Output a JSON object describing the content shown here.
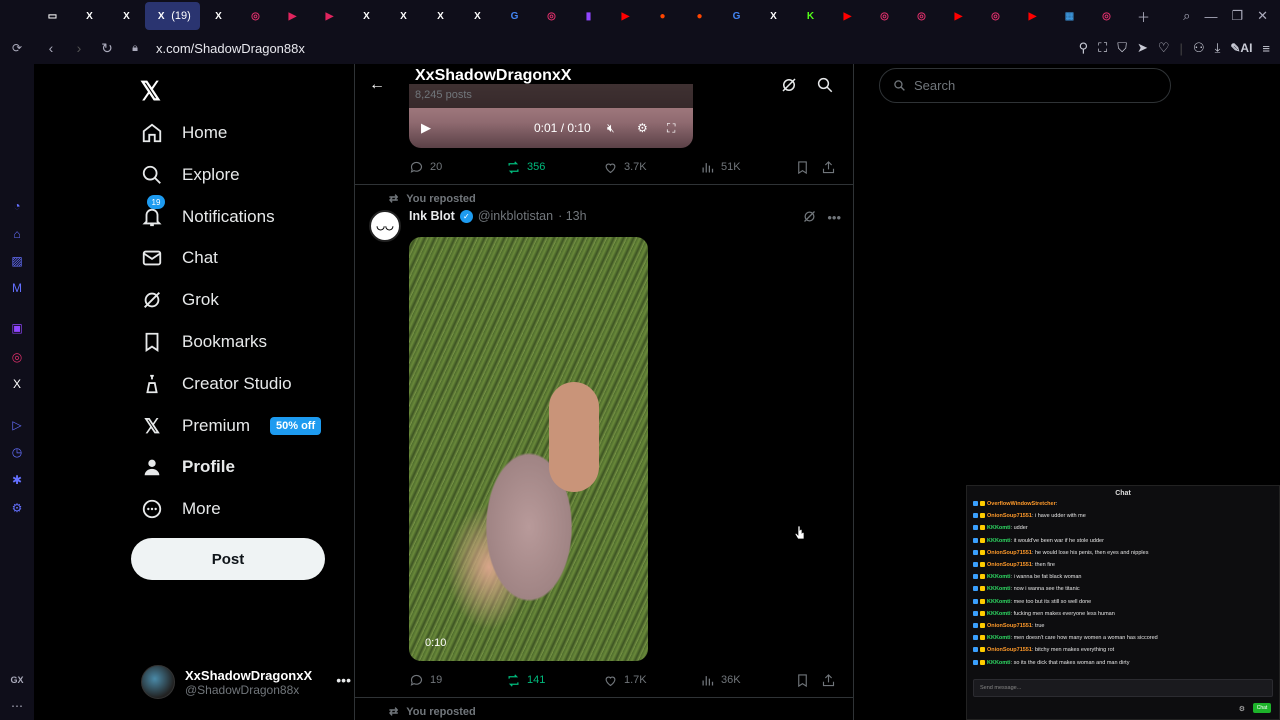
{
  "browser": {
    "active_tab_badge": "(19)",
    "url": "x.com/ShadowDragon88x",
    "ai_label": "AI",
    "gx_label": "GX",
    "tabs": [
      {
        "icon": "tv-icon",
        "color": "#ffffff"
      },
      {
        "icon": "x-icon",
        "color": "#ffffff"
      },
      {
        "icon": "x-icon",
        "color": "#ffffff"
      },
      {
        "icon": "x-icon",
        "color": "#ffffff",
        "active": true
      },
      {
        "icon": "x-icon",
        "color": "#ffffff"
      },
      {
        "icon": "instagram-icon",
        "color": "#e1306c"
      },
      {
        "icon": "play-icon",
        "color": "#e0245e"
      },
      {
        "icon": "play-icon",
        "color": "#e0245e"
      },
      {
        "icon": "x-icon",
        "color": "#ffffff"
      },
      {
        "icon": "x-icon",
        "color": "#ffffff"
      },
      {
        "icon": "x-icon",
        "color": "#ffffff"
      },
      {
        "icon": "x-icon",
        "color": "#ffffff"
      },
      {
        "icon": "google-icon",
        "color": "#4285f4"
      },
      {
        "icon": "instagram-icon",
        "color": "#e1306c"
      },
      {
        "icon": "twitch-icon",
        "color": "#9146ff"
      },
      {
        "icon": "youtube-icon",
        "color": "#ff0000"
      },
      {
        "icon": "reddit-icon",
        "color": "#ff4500"
      },
      {
        "icon": "reddit-icon",
        "color": "#ff4500"
      },
      {
        "icon": "google-icon",
        "color": "#4285f4"
      },
      {
        "icon": "x-icon",
        "color": "#ffffff"
      },
      {
        "icon": "kick-icon",
        "color": "#53fc18"
      },
      {
        "icon": "youtube-icon",
        "color": "#ff0000"
      },
      {
        "icon": "instagram-icon",
        "color": "#e1306c"
      },
      {
        "icon": "instagram-icon",
        "color": "#e1306c"
      },
      {
        "icon": "youtube-icon",
        "color": "#ff0000"
      },
      {
        "icon": "instagram-icon",
        "color": "#e1306c"
      },
      {
        "icon": "youtube-icon",
        "color": "#ff0000"
      },
      {
        "icon": "tweetdeck-icon",
        "color": "#3b94d9"
      },
      {
        "icon": "instagram-icon",
        "color": "#e1306c"
      }
    ]
  },
  "nav": {
    "items": [
      {
        "label": "Home",
        "icon": "home-icon"
      },
      {
        "label": "Explore",
        "icon": "search-icon"
      },
      {
        "label": "Notifications",
        "icon": "bell-icon",
        "badge": "19"
      },
      {
        "label": "Chat",
        "icon": "mail-icon"
      },
      {
        "label": "Grok",
        "icon": "grok-icon"
      },
      {
        "label": "Bookmarks",
        "icon": "bookmark-icon"
      },
      {
        "label": "Creator Studio",
        "icon": "creator-studio-icon"
      },
      {
        "label": "Premium",
        "icon": "x-icon",
        "badge": "50% off"
      },
      {
        "label": "Profile",
        "icon": "person-icon"
      },
      {
        "label": "More",
        "icon": "more-circle-icon"
      }
    ],
    "post_label": "Post",
    "account": {
      "name": "XxShadowDragonxX",
      "handle": "@ShadowDragon88x"
    }
  },
  "header": {
    "title": "XxShadowDragonxX",
    "post_count": "8,245 posts"
  },
  "first_post": {
    "video_time": "0:01 / 0:10",
    "replies": "20",
    "reposts": "356",
    "likes": "3.7K",
    "views": "51K"
  },
  "second_post": {
    "repost_label": "You reposted",
    "author_name": "Ink Blot",
    "author_handle": "@inkblotistan",
    "time": "· 13h",
    "video_duration": "0:10",
    "replies": "19",
    "reposts": "141",
    "likes": "1.7K",
    "views": "36K"
  },
  "third_post": {
    "repost_label": "You reposted"
  },
  "search": {
    "placeholder": "Search"
  },
  "chat": {
    "title": "Chat",
    "input_placeholder": "Send message...",
    "send_label": "Chat",
    "messages": [
      {
        "user": "OverflowWindowStretcher",
        "text": "",
        "color": "orange"
      },
      {
        "user": "OnionSoup71551",
        "text": "i have udder with me",
        "color": "orange"
      },
      {
        "user": "KKKomti",
        "text": "udder",
        "color": "green"
      },
      {
        "user": "KKKomti",
        "text": "it would've been war if he stole udder",
        "color": "green"
      },
      {
        "user": "OnionSoup71551",
        "text": "he would lose his penis, then eyes and nipples",
        "color": "orange"
      },
      {
        "user": "OnionSoup71551",
        "text": "then fire",
        "color": "orange"
      },
      {
        "user": "KKKomti",
        "text": "i wanna be fat black woman",
        "color": "green"
      },
      {
        "user": "KKKomti",
        "text": "now i wanna see the titanic",
        "color": "green"
      },
      {
        "user": "KKKomti",
        "text": "mee too but its still so well done",
        "color": "green"
      },
      {
        "user": "KKKomti",
        "text": "fucking men makes everyone less human",
        "color": "green"
      },
      {
        "user": "OnionSoup71551",
        "text": "true",
        "color": "orange"
      },
      {
        "user": "KKKomti",
        "text": "men doesn't care how many women a woman has siccored",
        "color": "green"
      },
      {
        "user": "OnionSoup71551",
        "text": "bitchy men makes everything rot",
        "color": "orange"
      },
      {
        "user": "KKKomti",
        "text": "so its the dick that makes woman and man dirty",
        "color": "green"
      }
    ]
  }
}
